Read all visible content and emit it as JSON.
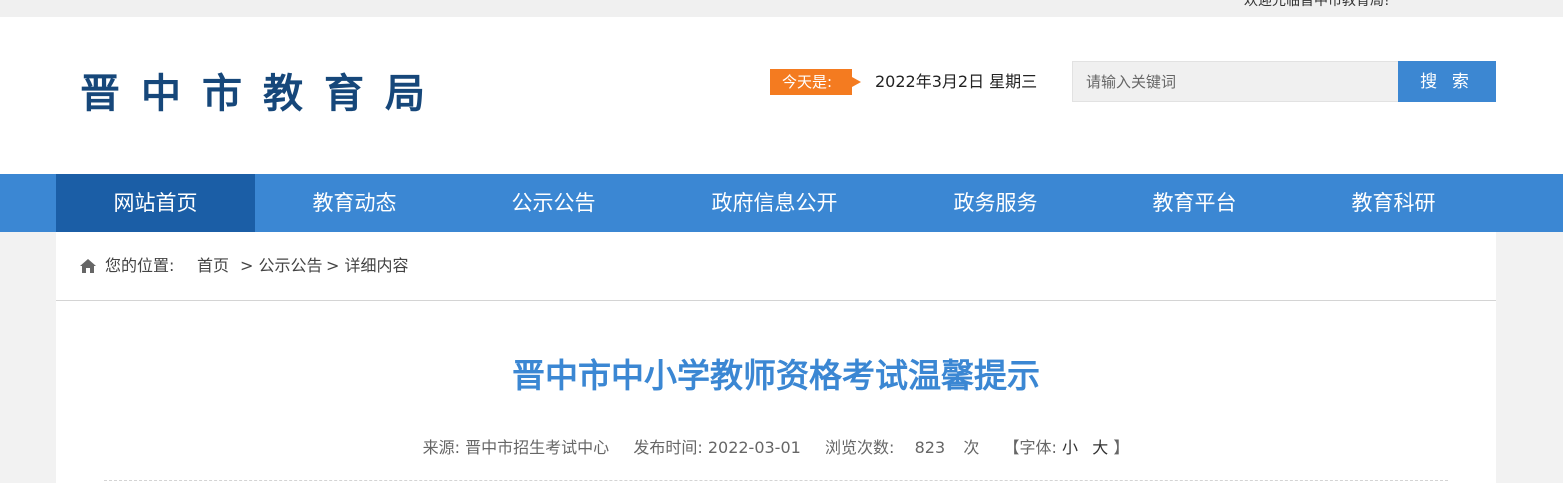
{
  "topbar": {
    "welcome": "欢迎光临晋中市教育局!"
  },
  "site": {
    "logo_text": "晋中市教育局"
  },
  "today": {
    "label": "今天是:",
    "date": "2022年3月2日 星期三"
  },
  "search": {
    "placeholder": "请输入关键词",
    "button_label": "搜 索"
  },
  "nav": {
    "items": [
      {
        "label": "网站首页",
        "active": true
      },
      {
        "label": "教育动态",
        "active": false
      },
      {
        "label": "公示公告",
        "active": false
      },
      {
        "label": "政府信息公开",
        "active": false
      },
      {
        "label": "政务服务",
        "active": false
      },
      {
        "label": "教育平台",
        "active": false
      },
      {
        "label": "教育科研",
        "active": false
      }
    ]
  },
  "breadcrumb": {
    "icon": "home-icon",
    "prefix": "您的位置:",
    "home": "首页",
    "section": "> 公示公告",
    "current": "> 详细内容"
  },
  "article": {
    "title": "晋中市中小学教师资格考试温馨提示",
    "source_label": "来源:",
    "source": "晋中市招生考试中心",
    "date_label": "发布时间:",
    "date": "2022-03-01",
    "views_label": "浏览次数:",
    "views": "823",
    "views_unit": "次",
    "font_label": "【字体:",
    "font_small": "小",
    "font_large": "大",
    "font_close": "】"
  },
  "colors": {
    "brand_blue": "#3b87d3",
    "nav_active": "#1b5ea6",
    "logo": "#16477a",
    "today_badge": "#f47b20"
  }
}
